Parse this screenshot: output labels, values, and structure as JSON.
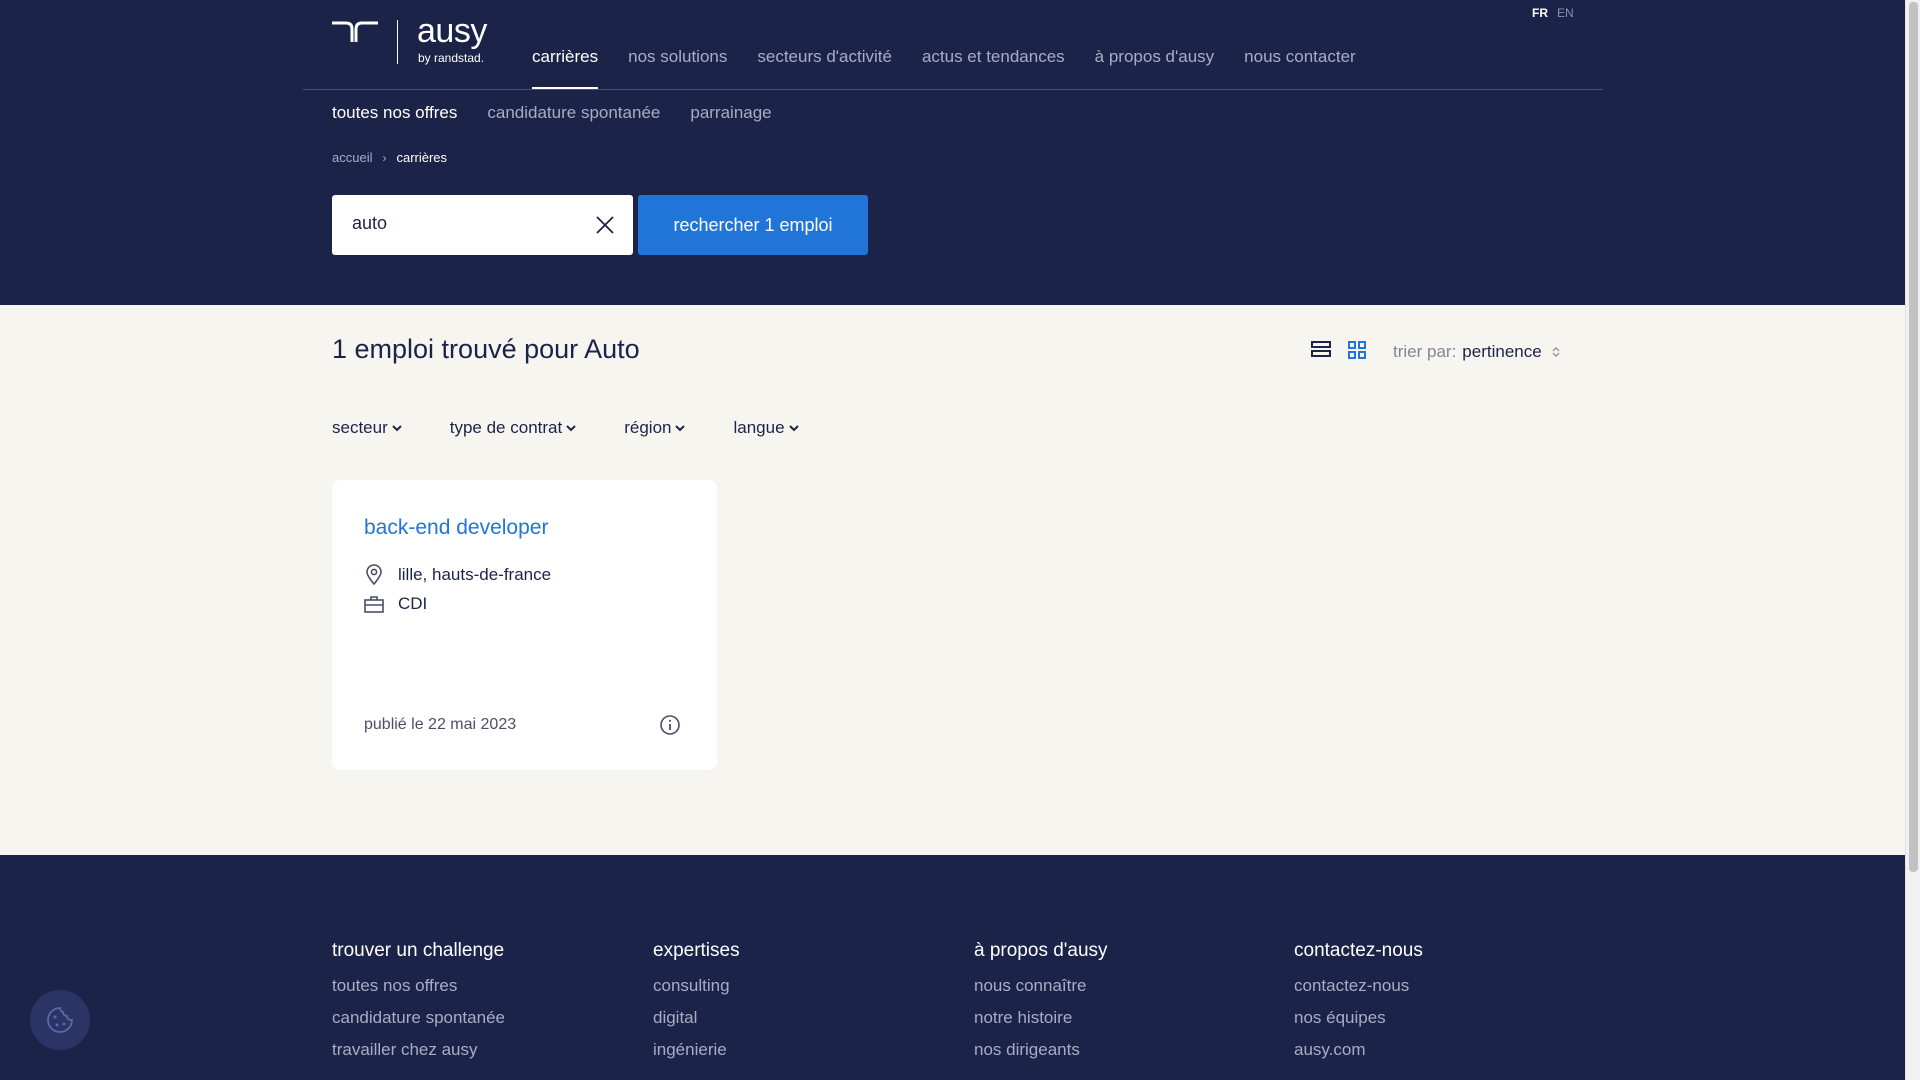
{
  "header": {
    "languages": [
      "FR",
      "EN"
    ],
    "logo": {
      "word": "ausy",
      "sub": "by randstad."
    },
    "main_nav": [
      "carrières",
      "nos solutions",
      "secteurs d'activité",
      "actus et tendances",
      "à propos d'ausy",
      "nous contacter"
    ],
    "sub_nav": [
      "toutes nos offres",
      "candidature spontanée",
      "parrainage"
    ],
    "breadcrumb": {
      "home": "accueil",
      "current": "carrières"
    }
  },
  "search": {
    "value": "auto",
    "button_label": "rechercher 1 emploi"
  },
  "results": {
    "title": "1 emploi trouvé pour Auto",
    "sort_label": "trier par:",
    "sort_value": "pertinence"
  },
  "filters": [
    "secteur",
    "type de contrat",
    "région",
    "langue"
  ],
  "jobs": [
    {
      "title": "back-end developer",
      "location": "lille, hauts-de-france",
      "contract": "CDI",
      "published": "publié le 22 mai 2023"
    }
  ],
  "footer": {
    "columns": [
      {
        "title": "trouver un challenge",
        "links": [
          "toutes nos offres",
          "candidature spontanée",
          "travailler chez ausy"
        ]
      },
      {
        "title": "expertises",
        "links": [
          "consulting",
          "digital",
          "ingénierie"
        ]
      },
      {
        "title": "à propos d'ausy",
        "links": [
          "nous connaître",
          "notre histoire",
          "nos dirigeants"
        ]
      },
      {
        "title": "contactez-nous",
        "links": [
          "contactez-nous",
          "nos équipes",
          "ausy.com"
        ]
      }
    ]
  },
  "colors": {
    "navy": "#1c2348",
    "accent_blue": "#2175d9",
    "background": "#f7f5f0"
  },
  "icons": [
    "clear-icon",
    "list-view-icon",
    "grid-view-icon",
    "sort-icon",
    "chevron-down-icon",
    "location-pin-icon",
    "briefcase-icon",
    "info-icon",
    "cookie-icon"
  ]
}
